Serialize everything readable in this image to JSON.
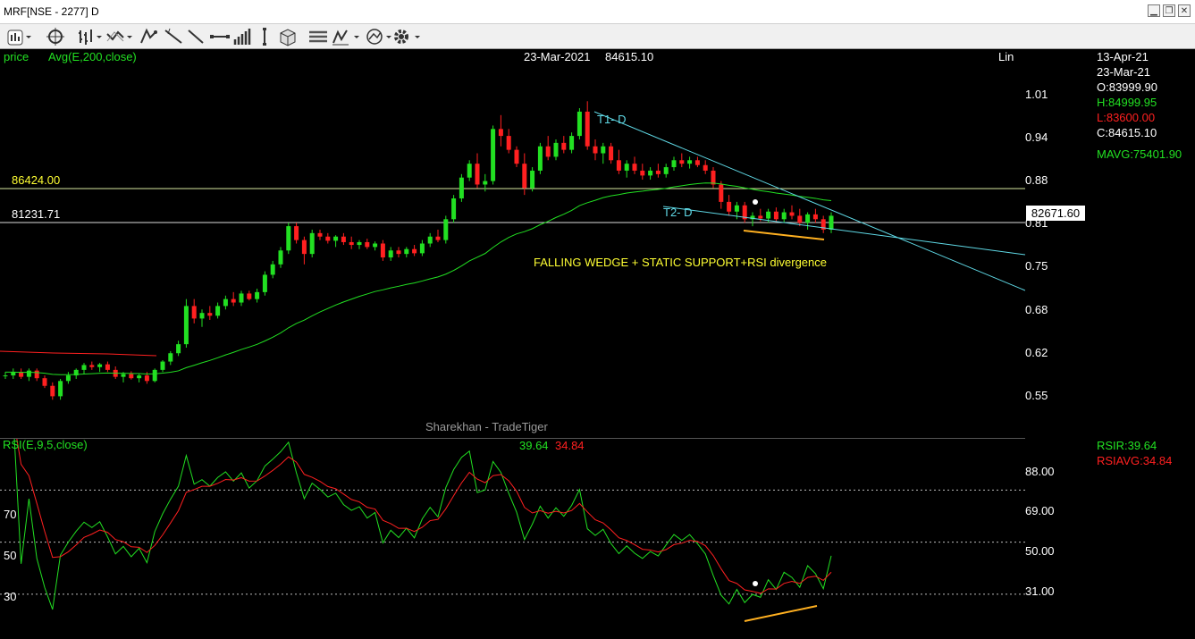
{
  "window": {
    "title": "MRF[NSE - 2277] D"
  },
  "toolbar": {
    "icons": [
      "chart-type-icon",
      "crosshair-icon",
      "bar-style-icon",
      "indicator-icon",
      "drawing-tools-icon",
      "trendline-icon",
      "horizontal-line-icon",
      "volume-bars-icon",
      "vertical-line-icon",
      "template-icon",
      "layout-icon",
      "fibonacci-icon",
      "compare-icon",
      "settings-icon"
    ]
  },
  "price_panel": {
    "label_price": "price",
    "label_avg": "Avg(E,200,close)",
    "header_date": "23-Mar-2021",
    "header_value": "84615.10",
    "corner_label": "Lin",
    "level1": "86424.00",
    "level2": "81231.71",
    "current_price": "82671.60",
    "annotation": "FALLING WEDGE  +  STATIC SUPPORT+RSI divergence",
    "t1_label": "T1- D",
    "t2_label": "T2- D",
    "watermark": "Sharekhan - TradeTiger",
    "axis_ticks": [
      "1.01",
      "0.94",
      "0.88",
      "0.81",
      "0.75",
      "0.68",
      "0.62",
      "0.55"
    ]
  },
  "info_box": {
    "date_top": "13-Apr-21",
    "date": "23-Mar-21",
    "open": "O:83999.90",
    "high": "H:84999.95",
    "low": "L:83600.00",
    "close": "C:84615.10",
    "mavg": "MAVG:75401.90",
    "rsir": "RSIR:39.64",
    "rsiavg": "RSIAVG:34.84"
  },
  "rsi_panel": {
    "label": "RSI(E,9,5,close)",
    "value": "39.64",
    "value_avg": "34.84",
    "left_ticks": [
      "70",
      "50",
      "30"
    ],
    "axis_ticks": [
      "88.00",
      "69.00",
      "50.00",
      "31.00"
    ]
  },
  "colors": {
    "up": "#22e022",
    "down": "#ff2020",
    "ma": "#22e022",
    "trend": "#5fd9e6",
    "yellow": "#ffff33",
    "orange": "#ffb020"
  },
  "chart_data": {
    "type": "candlestick",
    "note_scale": "price axis in lakhs",
    "ylim": [
      0.5,
      1.06
    ],
    "candles": [
      [
        0.59,
        0.595,
        0.585,
        0.59
      ],
      [
        0.59,
        0.6,
        0.585,
        0.595
      ],
      [
        0.595,
        0.6,
        0.585,
        0.588
      ],
      [
        0.588,
        0.6,
        0.582,
        0.597
      ],
      [
        0.597,
        0.6,
        0.582,
        0.586
      ],
      [
        0.586,
        0.59,
        0.572,
        0.575
      ],
      [
        0.575,
        0.58,
        0.555,
        0.56
      ],
      [
        0.56,
        0.585,
        0.555,
        0.582
      ],
      [
        0.582,
        0.595,
        0.578,
        0.59
      ],
      [
        0.59,
        0.6,
        0.585,
        0.598
      ],
      [
        0.598,
        0.608,
        0.592,
        0.605
      ],
      [
        0.605,
        0.61,
        0.598,
        0.602
      ],
      [
        0.602,
        0.608,
        0.595,
        0.606
      ],
      [
        0.606,
        0.61,
        0.595,
        0.598
      ],
      [
        0.598,
        0.603,
        0.585,
        0.588
      ],
      [
        0.588,
        0.595,
        0.58,
        0.592
      ],
      [
        0.592,
        0.596,
        0.584,
        0.586
      ],
      [
        0.586,
        0.592,
        0.58,
        0.59
      ],
      [
        0.59,
        0.595,
        0.578,
        0.582
      ],
      [
        0.582,
        0.6,
        0.58,
        0.598
      ],
      [
        0.598,
        0.612,
        0.595,
        0.61
      ],
      [
        0.61,
        0.625,
        0.605,
        0.622
      ],
      [
        0.622,
        0.64,
        0.618,
        0.635
      ],
      [
        0.635,
        0.7,
        0.63,
        0.69
      ],
      [
        0.69,
        0.7,
        0.665,
        0.672
      ],
      [
        0.672,
        0.685,
        0.66,
        0.68
      ],
      [
        0.68,
        0.69,
        0.67,
        0.676
      ],
      [
        0.676,
        0.695,
        0.672,
        0.69
      ],
      [
        0.69,
        0.705,
        0.685,
        0.7
      ],
      [
        0.7,
        0.71,
        0.69,
        0.695
      ],
      [
        0.695,
        0.712,
        0.69,
        0.708
      ],
      [
        0.708,
        0.712,
        0.698,
        0.7
      ],
      [
        0.7,
        0.715,
        0.695,
        0.71
      ],
      [
        0.71,
        0.74,
        0.705,
        0.735
      ],
      [
        0.735,
        0.755,
        0.73,
        0.75
      ],
      [
        0.75,
        0.775,
        0.745,
        0.77
      ],
      [
        0.77,
        0.81,
        0.765,
        0.805
      ],
      [
        0.805,
        0.81,
        0.78,
        0.785
      ],
      [
        0.785,
        0.79,
        0.75,
        0.765
      ],
      [
        0.765,
        0.8,
        0.76,
        0.795
      ],
      [
        0.795,
        0.8,
        0.785,
        0.79
      ],
      [
        0.79,
        0.795,
        0.78,
        0.784
      ],
      [
        0.784,
        0.792,
        0.775,
        0.79
      ],
      [
        0.79,
        0.795,
        0.778,
        0.782
      ],
      [
        0.782,
        0.79,
        0.772,
        0.778
      ],
      [
        0.778,
        0.785,
        0.772,
        0.782
      ],
      [
        0.782,
        0.787,
        0.772,
        0.775
      ],
      [
        0.775,
        0.783,
        0.77,
        0.78
      ],
      [
        0.78,
        0.785,
        0.755,
        0.76
      ],
      [
        0.76,
        0.775,
        0.755,
        0.77
      ],
      [
        0.77,
        0.775,
        0.76,
        0.765
      ],
      [
        0.765,
        0.775,
        0.76,
        0.772
      ],
      [
        0.772,
        0.778,
        0.762,
        0.766
      ],
      [
        0.766,
        0.785,
        0.762,
        0.78
      ],
      [
        0.78,
        0.795,
        0.775,
        0.79
      ],
      [
        0.79,
        0.8,
        0.782,
        0.785
      ],
      [
        0.785,
        0.82,
        0.78,
        0.815
      ],
      [
        0.815,
        0.85,
        0.81,
        0.845
      ],
      [
        0.845,
        0.88,
        0.84,
        0.875
      ],
      [
        0.875,
        0.9,
        0.87,
        0.895
      ],
      [
        0.895,
        0.91,
        0.86,
        0.865
      ],
      [
        0.865,
        0.88,
        0.855,
        0.87
      ],
      [
        0.87,
        0.95,
        0.865,
        0.945
      ],
      [
        0.945,
        0.965,
        0.92,
        0.935
      ],
      [
        0.935,
        0.945,
        0.91,
        0.915
      ],
      [
        0.915,
        0.92,
        0.89,
        0.895
      ],
      [
        0.895,
        0.91,
        0.85,
        0.86
      ],
      [
        0.86,
        0.89,
        0.855,
        0.885
      ],
      [
        0.885,
        0.925,
        0.88,
        0.92
      ],
      [
        0.92,
        0.935,
        0.9,
        0.905
      ],
      [
        0.905,
        0.93,
        0.9,
        0.925
      ],
      [
        0.925,
        0.935,
        0.91,
        0.915
      ],
      [
        0.915,
        0.94,
        0.91,
        0.935
      ],
      [
        0.935,
        0.975,
        0.93,
        0.97
      ],
      [
        0.97,
        0.985,
        0.915,
        0.92
      ],
      [
        0.92,
        0.93,
        0.9,
        0.91
      ],
      [
        0.91,
        0.925,
        0.895,
        0.92
      ],
      [
        0.92,
        0.925,
        0.895,
        0.9
      ],
      [
        0.9,
        0.915,
        0.88,
        0.885
      ],
      [
        0.885,
        0.9,
        0.875,
        0.895
      ],
      [
        0.895,
        0.905,
        0.88,
        0.885
      ],
      [
        0.885,
        0.895,
        0.872,
        0.878
      ],
      [
        0.878,
        0.89,
        0.872,
        0.885
      ],
      [
        0.885,
        0.895,
        0.875,
        0.88
      ],
      [
        0.88,
        0.895,
        0.875,
        0.89
      ],
      [
        0.89,
        0.905,
        0.885,
        0.9
      ],
      [
        0.9,
        0.91,
        0.89,
        0.895
      ],
      [
        0.895,
        0.905,
        0.888,
        0.9
      ],
      [
        0.9,
        0.905,
        0.89,
        0.893
      ],
      [
        0.893,
        0.9,
        0.88,
        0.885
      ],
      [
        0.885,
        0.89,
        0.86,
        0.865
      ],
      [
        0.865,
        0.87,
        0.83,
        0.84
      ],
      [
        0.84,
        0.85,
        0.82,
        0.826
      ],
      [
        0.826,
        0.84,
        0.815,
        0.835
      ],
      [
        0.835,
        0.84,
        0.81,
        0.815
      ],
      [
        0.815,
        0.825,
        0.805,
        0.82
      ],
      [
        0.82,
        0.83,
        0.812,
        0.816
      ],
      [
        0.816,
        0.83,
        0.81,
        0.826
      ],
      [
        0.826,
        0.832,
        0.812,
        0.815
      ],
      [
        0.815,
        0.83,
        0.81,
        0.825
      ],
      [
        0.825,
        0.835,
        0.815,
        0.82
      ],
      [
        0.82,
        0.83,
        0.805,
        0.81
      ],
      [
        0.81,
        0.825,
        0.8,
        0.822
      ],
      [
        0.822,
        0.83,
        0.81,
        0.815
      ],
      [
        0.815,
        0.82,
        0.795,
        0.8
      ],
      [
        0.8,
        0.825,
        0.795,
        0.82
      ]
    ]
  }
}
